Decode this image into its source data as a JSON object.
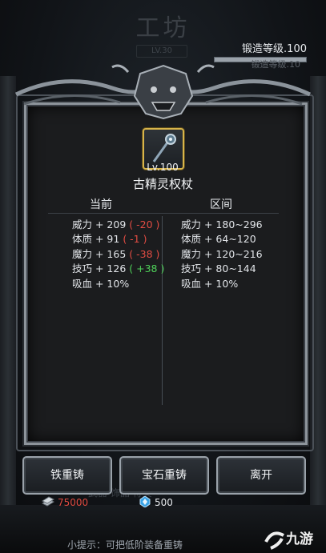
{
  "background": {
    "title": "工坊",
    "level_badge": "LV.30",
    "forge_level_label": "锻造等级.100",
    "forge_level_bg_label": "锻造等级.10",
    "tabs_hint": "武器   饰品   符文",
    "tip": "小提示：可把低阶装备重铸"
  },
  "item": {
    "level": "Lv.100",
    "name": "古精灵权杖",
    "icon": "staff-icon",
    "frame_color": "#d8b44a"
  },
  "columns": {
    "current": "当前",
    "range": "区间"
  },
  "current_stats": [
    {
      "label": "威力 + 209",
      "delta": "( -20 )",
      "sign": "neg"
    },
    {
      "label": "体质 + 91",
      "delta": "( -1 )",
      "sign": "neg"
    },
    {
      "label": "魔力 + 165",
      "delta": "( -38 )",
      "sign": "neg"
    },
    {
      "label": "技巧 + 126",
      "delta": "( +38 )",
      "sign": "pos"
    },
    {
      "label": "吸血 + 10%",
      "delta": "",
      "sign": ""
    }
  ],
  "range_stats": [
    "威力 + 180~296",
    "体质 + 64~120",
    "魔力 + 120~216",
    "技巧 + 80~144",
    "吸血 + 10%"
  ],
  "buttons": {
    "iron_recast": "铁重铸",
    "gem_recast": "宝石重铸",
    "leave": "离开"
  },
  "currency": {
    "iron": "75000",
    "gem": "500",
    "iron_color": "#e04a40"
  },
  "watermark": {
    "text": "九游"
  }
}
